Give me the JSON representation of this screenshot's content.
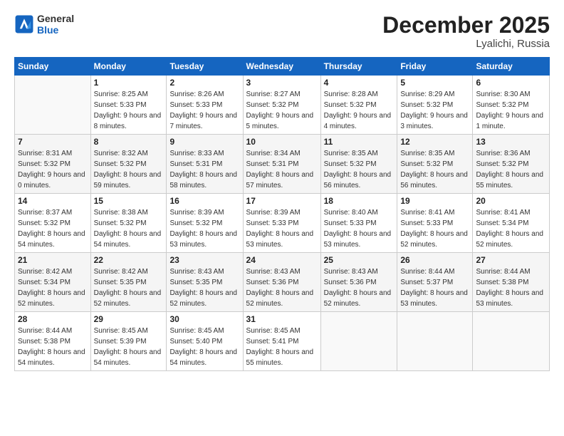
{
  "logo": {
    "line1": "General",
    "line2": "Blue"
  },
  "header": {
    "month": "December 2025",
    "location": "Lyalichi, Russia"
  },
  "weekdays": [
    "Sunday",
    "Monday",
    "Tuesday",
    "Wednesday",
    "Thursday",
    "Friday",
    "Saturday"
  ],
  "weeks": [
    [
      {
        "day": "",
        "sunrise": "",
        "sunset": "",
        "daylight": ""
      },
      {
        "day": "1",
        "sunrise": "Sunrise: 8:25 AM",
        "sunset": "Sunset: 5:33 PM",
        "daylight": "Daylight: 9 hours and 8 minutes."
      },
      {
        "day": "2",
        "sunrise": "Sunrise: 8:26 AM",
        "sunset": "Sunset: 5:33 PM",
        "daylight": "Daylight: 9 hours and 7 minutes."
      },
      {
        "day": "3",
        "sunrise": "Sunrise: 8:27 AM",
        "sunset": "Sunset: 5:32 PM",
        "daylight": "Daylight: 9 hours and 5 minutes."
      },
      {
        "day": "4",
        "sunrise": "Sunrise: 8:28 AM",
        "sunset": "Sunset: 5:32 PM",
        "daylight": "Daylight: 9 hours and 4 minutes."
      },
      {
        "day": "5",
        "sunrise": "Sunrise: 8:29 AM",
        "sunset": "Sunset: 5:32 PM",
        "daylight": "Daylight: 9 hours and 3 minutes."
      },
      {
        "day": "6",
        "sunrise": "Sunrise: 8:30 AM",
        "sunset": "Sunset: 5:32 PM",
        "daylight": "Daylight: 9 hours and 1 minute."
      }
    ],
    [
      {
        "day": "7",
        "sunrise": "Sunrise: 8:31 AM",
        "sunset": "Sunset: 5:32 PM",
        "daylight": "Daylight: 9 hours and 0 minutes."
      },
      {
        "day": "8",
        "sunrise": "Sunrise: 8:32 AM",
        "sunset": "Sunset: 5:32 PM",
        "daylight": "Daylight: 8 hours and 59 minutes."
      },
      {
        "day": "9",
        "sunrise": "Sunrise: 8:33 AM",
        "sunset": "Sunset: 5:31 PM",
        "daylight": "Daylight: 8 hours and 58 minutes."
      },
      {
        "day": "10",
        "sunrise": "Sunrise: 8:34 AM",
        "sunset": "Sunset: 5:31 PM",
        "daylight": "Daylight: 8 hours and 57 minutes."
      },
      {
        "day": "11",
        "sunrise": "Sunrise: 8:35 AM",
        "sunset": "Sunset: 5:32 PM",
        "daylight": "Daylight: 8 hours and 56 minutes."
      },
      {
        "day": "12",
        "sunrise": "Sunrise: 8:35 AM",
        "sunset": "Sunset: 5:32 PM",
        "daylight": "Daylight: 8 hours and 56 minutes."
      },
      {
        "day": "13",
        "sunrise": "Sunrise: 8:36 AM",
        "sunset": "Sunset: 5:32 PM",
        "daylight": "Daylight: 8 hours and 55 minutes."
      }
    ],
    [
      {
        "day": "14",
        "sunrise": "Sunrise: 8:37 AM",
        "sunset": "Sunset: 5:32 PM",
        "daylight": "Daylight: 8 hours and 54 minutes."
      },
      {
        "day": "15",
        "sunrise": "Sunrise: 8:38 AM",
        "sunset": "Sunset: 5:32 PM",
        "daylight": "Daylight: 8 hours and 54 minutes."
      },
      {
        "day": "16",
        "sunrise": "Sunrise: 8:39 AM",
        "sunset": "Sunset: 5:32 PM",
        "daylight": "Daylight: 8 hours and 53 minutes."
      },
      {
        "day": "17",
        "sunrise": "Sunrise: 8:39 AM",
        "sunset": "Sunset: 5:33 PM",
        "daylight": "Daylight: 8 hours and 53 minutes."
      },
      {
        "day": "18",
        "sunrise": "Sunrise: 8:40 AM",
        "sunset": "Sunset: 5:33 PM",
        "daylight": "Daylight: 8 hours and 53 minutes."
      },
      {
        "day": "19",
        "sunrise": "Sunrise: 8:41 AM",
        "sunset": "Sunset: 5:33 PM",
        "daylight": "Daylight: 8 hours and 52 minutes."
      },
      {
        "day": "20",
        "sunrise": "Sunrise: 8:41 AM",
        "sunset": "Sunset: 5:34 PM",
        "daylight": "Daylight: 8 hours and 52 minutes."
      }
    ],
    [
      {
        "day": "21",
        "sunrise": "Sunrise: 8:42 AM",
        "sunset": "Sunset: 5:34 PM",
        "daylight": "Daylight: 8 hours and 52 minutes."
      },
      {
        "day": "22",
        "sunrise": "Sunrise: 8:42 AM",
        "sunset": "Sunset: 5:35 PM",
        "daylight": "Daylight: 8 hours and 52 minutes."
      },
      {
        "day": "23",
        "sunrise": "Sunrise: 8:43 AM",
        "sunset": "Sunset: 5:35 PM",
        "daylight": "Daylight: 8 hours and 52 minutes."
      },
      {
        "day": "24",
        "sunrise": "Sunrise: 8:43 AM",
        "sunset": "Sunset: 5:36 PM",
        "daylight": "Daylight: 8 hours and 52 minutes."
      },
      {
        "day": "25",
        "sunrise": "Sunrise: 8:43 AM",
        "sunset": "Sunset: 5:36 PM",
        "daylight": "Daylight: 8 hours and 52 minutes."
      },
      {
        "day": "26",
        "sunrise": "Sunrise: 8:44 AM",
        "sunset": "Sunset: 5:37 PM",
        "daylight": "Daylight: 8 hours and 53 minutes."
      },
      {
        "day": "27",
        "sunrise": "Sunrise: 8:44 AM",
        "sunset": "Sunset: 5:38 PM",
        "daylight": "Daylight: 8 hours and 53 minutes."
      }
    ],
    [
      {
        "day": "28",
        "sunrise": "Sunrise: 8:44 AM",
        "sunset": "Sunset: 5:38 PM",
        "daylight": "Daylight: 8 hours and 54 minutes."
      },
      {
        "day": "29",
        "sunrise": "Sunrise: 8:45 AM",
        "sunset": "Sunset: 5:39 PM",
        "daylight": "Daylight: 8 hours and 54 minutes."
      },
      {
        "day": "30",
        "sunrise": "Sunrise: 8:45 AM",
        "sunset": "Sunset: 5:40 PM",
        "daylight": "Daylight: 8 hours and 54 minutes."
      },
      {
        "day": "31",
        "sunrise": "Sunrise: 8:45 AM",
        "sunset": "Sunset: 5:41 PM",
        "daylight": "Daylight: 8 hours and 55 minutes."
      },
      {
        "day": "",
        "sunrise": "",
        "sunset": "",
        "daylight": ""
      },
      {
        "day": "",
        "sunrise": "",
        "sunset": "",
        "daylight": ""
      },
      {
        "day": "",
        "sunrise": "",
        "sunset": "",
        "daylight": ""
      }
    ]
  ]
}
